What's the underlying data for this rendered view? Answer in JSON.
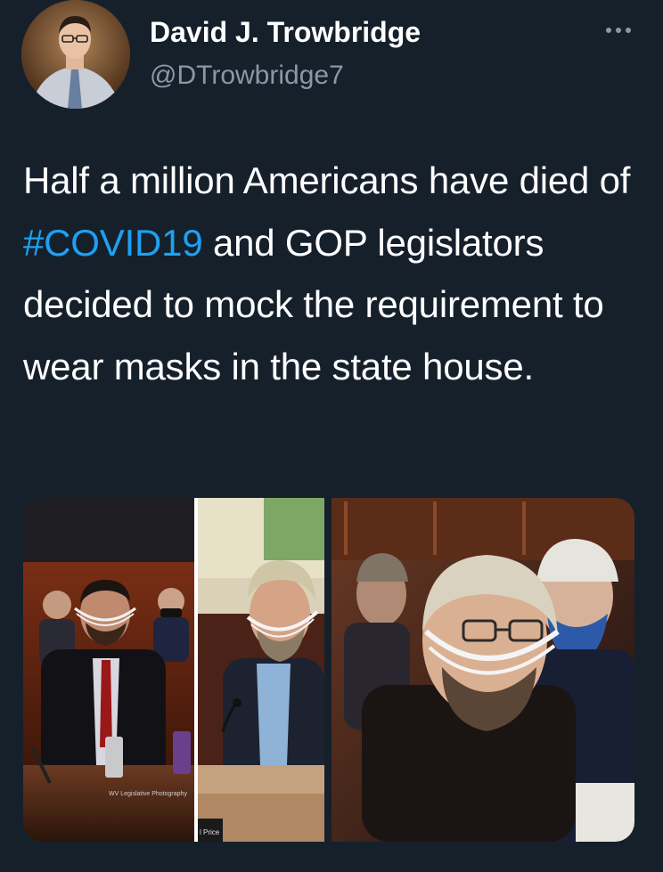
{
  "tweet": {
    "author": {
      "display_name": "David J. Trowbridge",
      "handle": "@DTrowbridge7",
      "avatar_icon": "profile-photo"
    },
    "menu_icon": "more-options-icon",
    "text_parts": [
      "Half a million Americans have died of ",
      "#COVID19",
      " and GOP legislators decided to mock the requirement to wear masks in the state house."
    ],
    "hashtag_color": "#1da1f2",
    "media": {
      "count": 3,
      "captions": [
        "WV Legislative Photography",
        "l Price"
      ]
    }
  },
  "colors": {
    "background": "#15202b",
    "text": "#ffffff",
    "secondary": "#8899a6"
  }
}
